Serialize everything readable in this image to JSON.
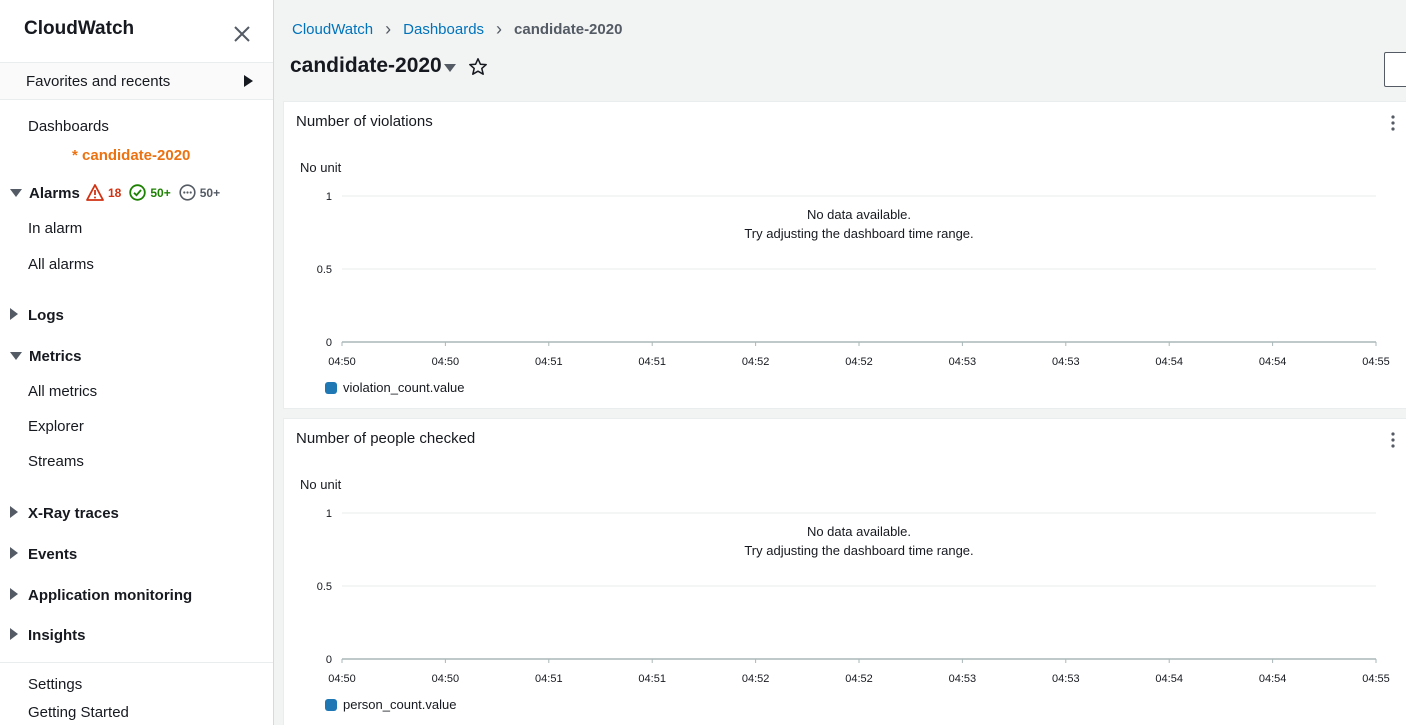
{
  "sidebar": {
    "title": "CloudWatch",
    "favorites": "Favorites and recents",
    "dashboards": "Dashboards",
    "active_dashboard": "* candidate-2020",
    "alarms": {
      "label": "Alarms",
      "in_alarm_count": "18",
      "ok_count": "50+",
      "insufficient_count": "50+",
      "items": [
        "In alarm",
        "All alarms"
      ]
    },
    "logs": "Logs",
    "metrics": {
      "label": "Metrics",
      "items": [
        "All metrics",
        "Explorer",
        "Streams"
      ]
    },
    "xray": "X-Ray traces",
    "events": "Events",
    "app_monitoring": "Application monitoring",
    "insights": "Insights",
    "settings": "Settings",
    "getting_started": "Getting Started"
  },
  "breadcrumb": {
    "items": [
      "CloudWatch",
      "Dashboards"
    ],
    "current": "candidate-2020"
  },
  "page": {
    "title": "candidate-2020"
  },
  "widgets": [
    {
      "title": "Number of violations",
      "unit": "No unit",
      "no_data": "No data available.",
      "no_data_hint": "Try adjusting the dashboard time range.",
      "legend": "violation_count.value"
    },
    {
      "title": "Number of people checked",
      "unit": "No unit",
      "no_data": "No data available.",
      "no_data_hint": "Try adjusting the dashboard time range.",
      "legend": "person_count.value"
    }
  ],
  "chart_data": [
    {
      "type": "line",
      "ylabel": "No unit",
      "y_ticks": [
        "1",
        "0.5",
        "0"
      ],
      "ylim": [
        0,
        1
      ],
      "x": [
        "04:50",
        "04:50",
        "04:51",
        "04:51",
        "04:52",
        "04:52",
        "04:53",
        "04:53",
        "04:54",
        "04:54",
        "04:55"
      ],
      "series": [
        {
          "name": "violation_count.value",
          "values": []
        }
      ],
      "legend": "bottom-left",
      "grid": true,
      "colors": {
        "series": "#1f77b4"
      }
    },
    {
      "type": "line",
      "ylabel": "No unit",
      "y_ticks": [
        "1",
        "0.5",
        "0"
      ],
      "ylim": [
        0,
        1
      ],
      "x": [
        "04:50",
        "04:50",
        "04:51",
        "04:51",
        "04:52",
        "04:52",
        "04:53",
        "04:53",
        "04:54",
        "04:54",
        "04:55"
      ],
      "series": [
        {
          "name": "person_count.value",
          "values": []
        }
      ],
      "legend": "bottom-left",
      "grid": true,
      "colors": {
        "series": "#1f77b4"
      }
    }
  ],
  "colors": {
    "link": "#0073bb",
    "active": "#ec7211",
    "alarm": "#d13212",
    "ok": "#1d8102"
  }
}
